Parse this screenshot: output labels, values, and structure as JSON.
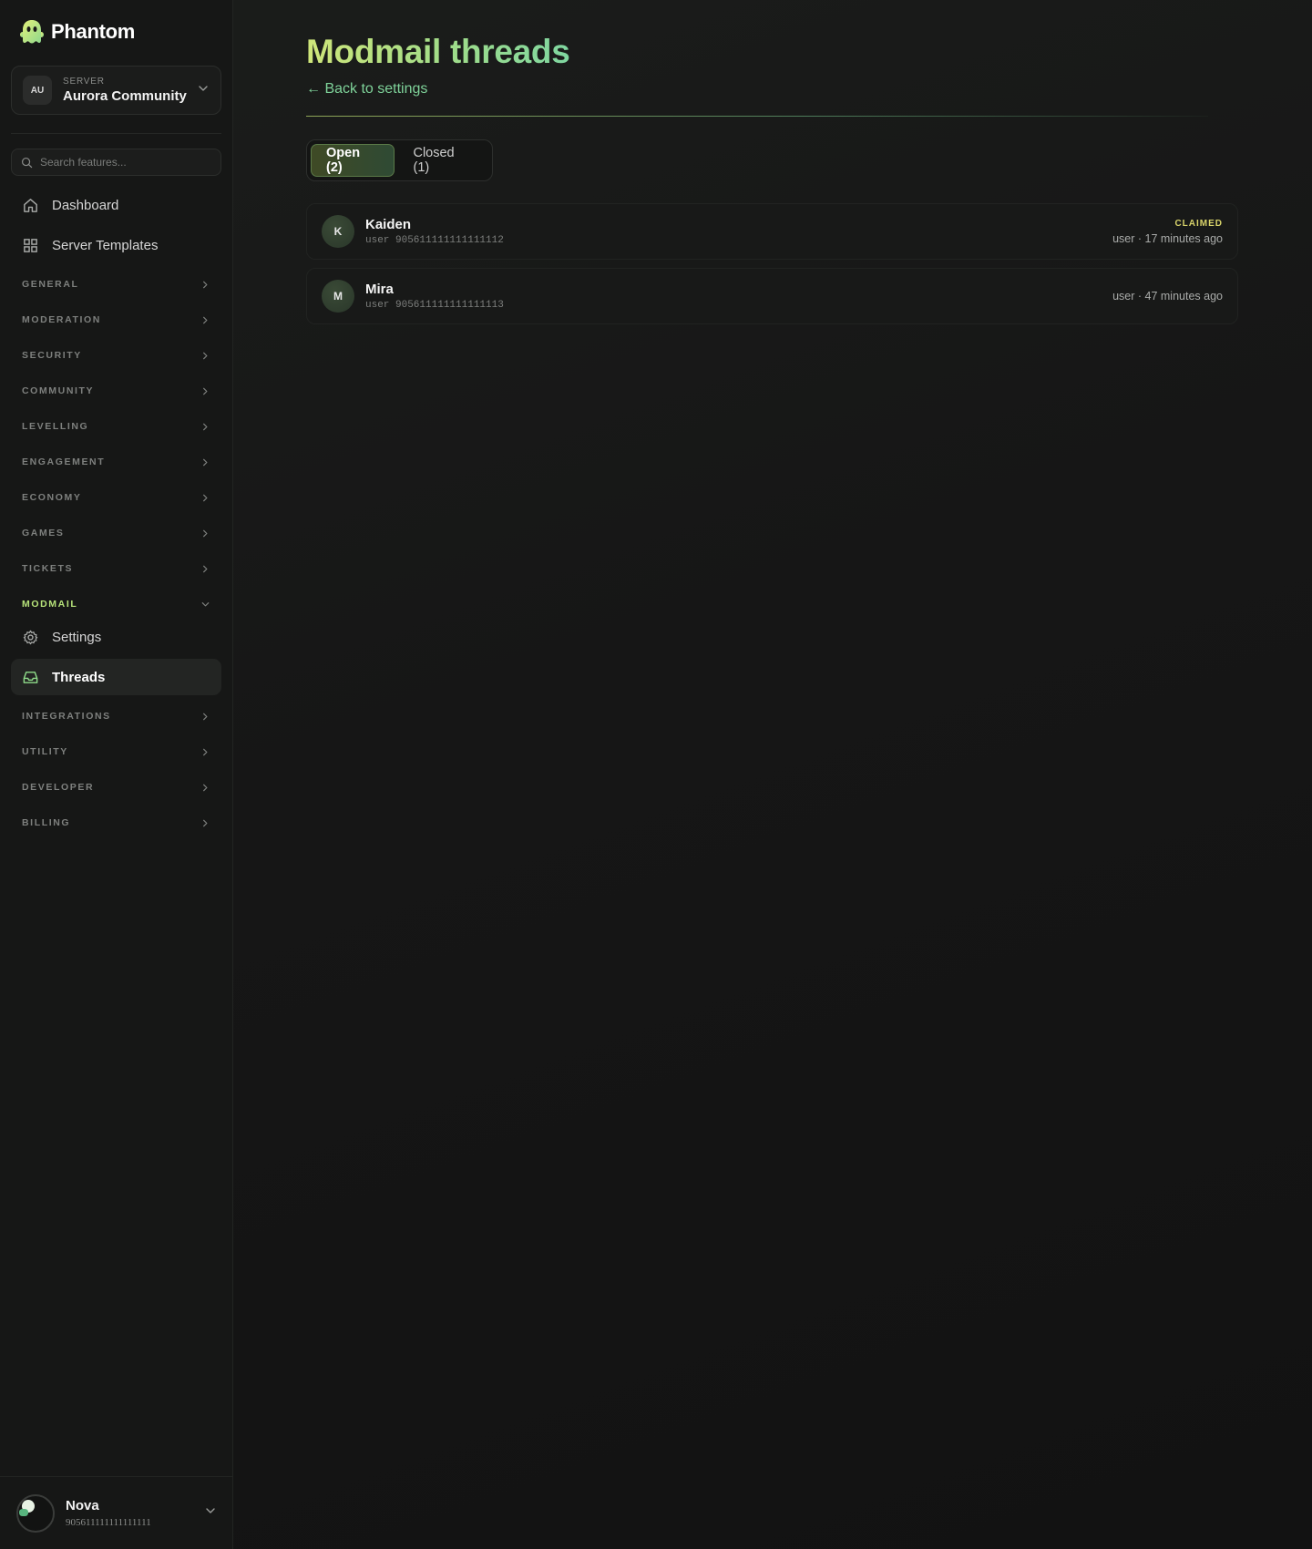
{
  "brand": {
    "name": "Phantom"
  },
  "server": {
    "kicker": "SERVER",
    "avatar": "AU",
    "name": "Aurora Community"
  },
  "search": {
    "placeholder": "Search features..."
  },
  "nav": {
    "dashboard": "Dashboard",
    "templates": "Server Templates"
  },
  "sections": {
    "general": "GENERAL",
    "moderation": "MODERATION",
    "security": "SECURITY",
    "community": "COMMUNITY",
    "levelling": "LEVELLING",
    "engagement": "ENGAGEMENT",
    "economy": "ECONOMY",
    "games": "GAMES",
    "tickets": "TICKETS",
    "modmail": "MODMAIL",
    "integrations": "INTEGRATIONS",
    "utility": "UTILITY",
    "developer": "DEVELOPER",
    "billing": "BILLING"
  },
  "modmail_items": {
    "settings": "Settings",
    "threads": "Threads"
  },
  "user": {
    "name": "Nova",
    "id": "905611111111111111"
  },
  "page": {
    "title": "Modmail threads",
    "back_link": "← Back to settings"
  },
  "tabs": {
    "open": "Open (2)",
    "closed": "Closed (1)"
  },
  "threads": [
    {
      "avatar": "K",
      "name": "Kaiden",
      "sub": "user 905611111111111112",
      "badge": "CLAIMED",
      "time": "user · 17 minutes ago"
    },
    {
      "avatar": "M",
      "name": "Mira",
      "sub": "user 905611111111111113",
      "badge": "",
      "time": "user · 47 minutes ago"
    }
  ],
  "colors": {
    "accent_lime": "#cfe67a",
    "accent_mint": "#7fd39a",
    "claimed": "#d8d36a",
    "background": "#161616"
  }
}
